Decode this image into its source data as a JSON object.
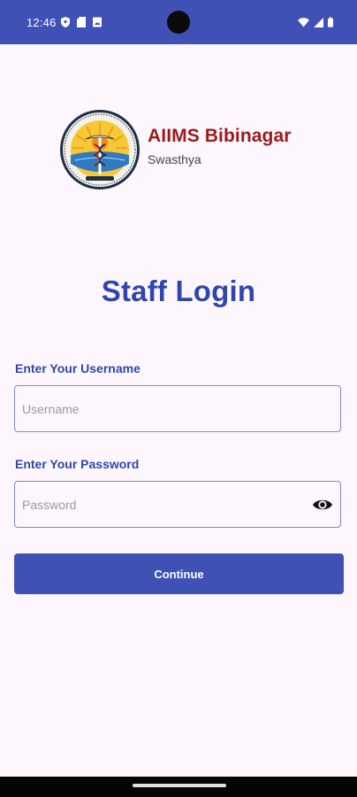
{
  "status_bar": {
    "time": "12:46",
    "left_icons": [
      "shield-icon",
      "sd-card-icon",
      "image-icon"
    ],
    "right_icons": [
      "wifi-icon",
      "signal-icon",
      "battery-icon"
    ],
    "background": "#3f51b5"
  },
  "brand": {
    "name": "AIIMS Bibinagar",
    "subtitle": "Swasthya",
    "name_color": "#9b1b1b"
  },
  "page": {
    "title": "Staff Login",
    "accent": "#2f46ad"
  },
  "form": {
    "username_label": "Enter Your Username",
    "username_placeholder": "Username",
    "username_value": "",
    "password_label": "Enter Your Password",
    "password_placeholder": "Password",
    "password_value": "",
    "password_toggle_icon": "eye-icon"
  },
  "actions": {
    "continue_label": "Continue",
    "button_color": "#3f51b5"
  }
}
